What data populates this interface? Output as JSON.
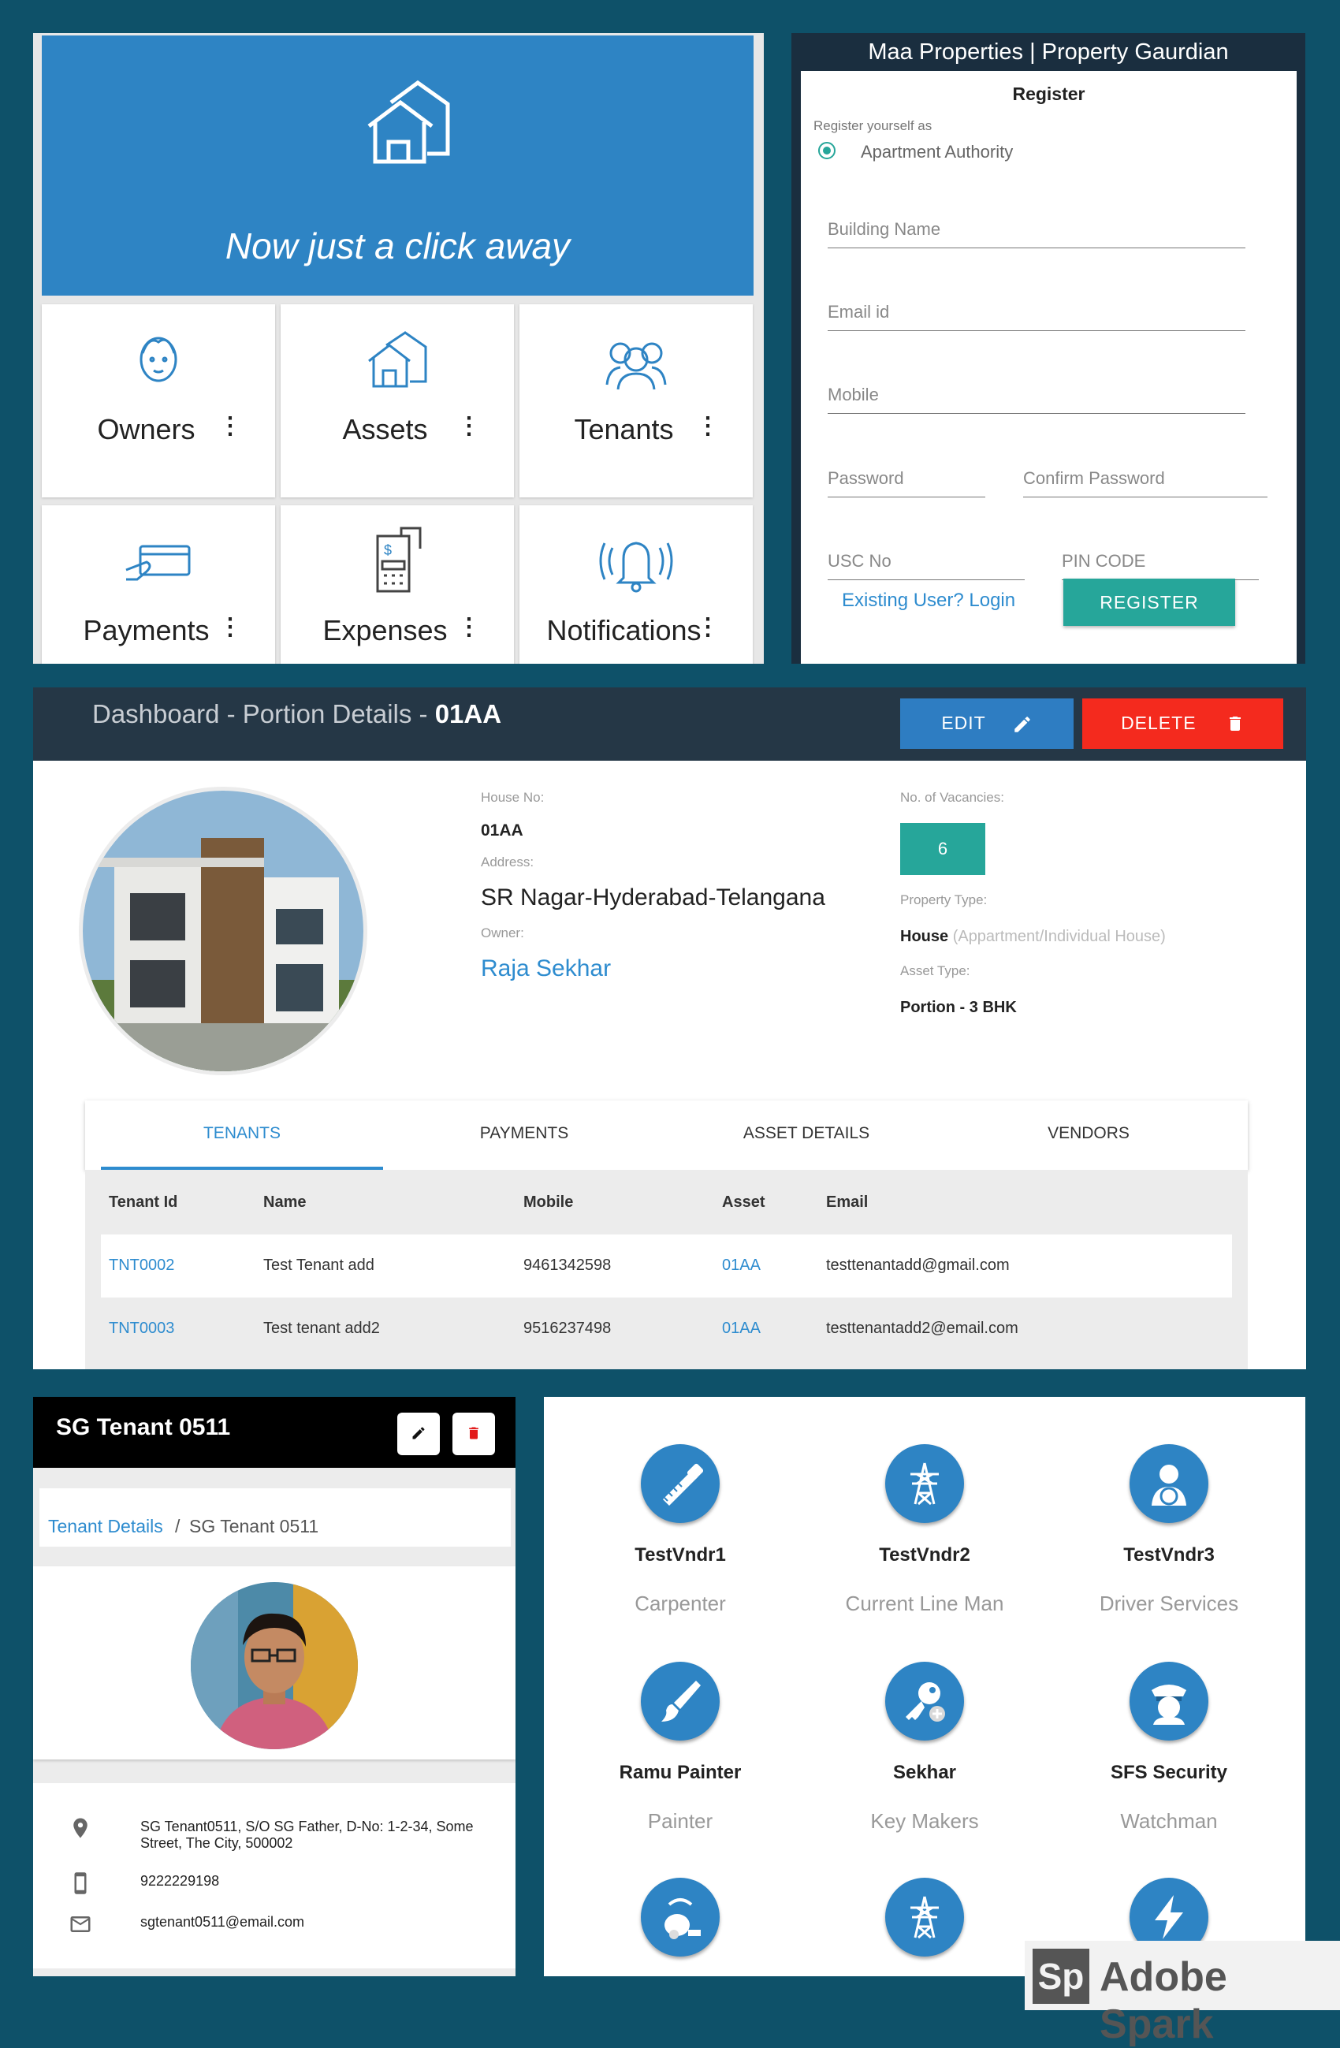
{
  "home": {
    "tagline": "Now just a click away",
    "tiles": [
      {
        "label": "Owners",
        "icon": "owner-face-icon"
      },
      {
        "label": "Assets",
        "icon": "houses-icon"
      },
      {
        "label": "Tenants",
        "icon": "people-group-icon"
      },
      {
        "label": "Payments",
        "icon": "card-payment-icon"
      },
      {
        "label": "Expenses",
        "icon": "receipt-calculator-icon"
      },
      {
        "label": "Notifications",
        "icon": "bell-icon"
      }
    ],
    "more": "⋮"
  },
  "register": {
    "app_title": "Maa Properties | Property Gaurdian",
    "heading": "Register",
    "register_as_label": "Register yourself as",
    "role_option": "Apartment Authority",
    "fields": {
      "building_name": "Building Name",
      "email": "Email id",
      "mobile": "Mobile",
      "password": "Password",
      "confirm_password": "Confirm Password",
      "usc_no": "USC No",
      "pin_code": "PIN CODE"
    },
    "login_link": "Existing User? Login",
    "submit": "REGISTER",
    "accent": "#26a69a"
  },
  "portion": {
    "title_prefix": "Dashboard - Portion Details - ",
    "title_id": "01AA",
    "edit": "EDIT",
    "delete": "DELETE",
    "house_no_label": "House No:",
    "house_no": "01AA",
    "address_label": "Address:",
    "address": "SR Nagar-Hyderabad-Telangana",
    "owner_label": "Owner:",
    "owner": "Raja Sekhar",
    "vacancies_label": "No. of Vacancies:",
    "vacancies": "6",
    "property_type_label": "Property Type:",
    "property_type": "House",
    "property_type_hint": "(Appartment/Individual House)",
    "asset_type_label": "Asset Type:",
    "asset_type": "Portion - 3 BHK",
    "tabs": [
      "TENANTS",
      "PAYMENTS",
      "ASSET DETAILS",
      "VENDORS"
    ],
    "columns": [
      "Tenant Id",
      "Name",
      "Mobile",
      "Asset",
      "Email"
    ],
    "rows": [
      {
        "id": "TNT0002",
        "name": "Test Tenant add",
        "mobile": "9461342598",
        "asset": "01AA",
        "email": "testtenantadd@gmail.com"
      },
      {
        "id": "TNT0003",
        "name": "Test tenant add2",
        "mobile": "9516237498",
        "asset": "01AA",
        "email": "testtenantadd2@email.com"
      }
    ]
  },
  "tenant": {
    "title": "SG Tenant 0511",
    "breadcrumb_link": "Tenant Details",
    "breadcrumb_sep": "/",
    "breadcrumb_current": "SG Tenant 0511",
    "address": "SG Tenant0511, S/O SG Father, D-No: 1-2-34, Some Street, The City, 500002",
    "phone": "9222229198",
    "email": "sgtenant0511@email.com"
  },
  "vendors": [
    {
      "name": "TestVndr1",
      "role": "Carpenter",
      "icon": "saw-icon"
    },
    {
      "name": "TestVndr2",
      "role": "Current Line Man",
      "icon": "power-tower-icon"
    },
    {
      "name": "TestVndr3",
      "role": "Driver Services",
      "icon": "driver-icon"
    },
    {
      "name": "Ramu Painter",
      "role": "Painter",
      "icon": "paint-brush-icon"
    },
    {
      "name": "Sekhar",
      "role": "Key Makers",
      "icon": "key-icon"
    },
    {
      "name": "SFS Security",
      "role": "Watchman",
      "icon": "security-guard-icon"
    },
    {
      "icon": "vacuum-cleaner-icon"
    },
    {
      "icon": "power-tower-icon"
    },
    {
      "icon": "lightning-icon"
    }
  ],
  "watermark": {
    "logo": "Sp",
    "text": "Adobe Spark"
  }
}
